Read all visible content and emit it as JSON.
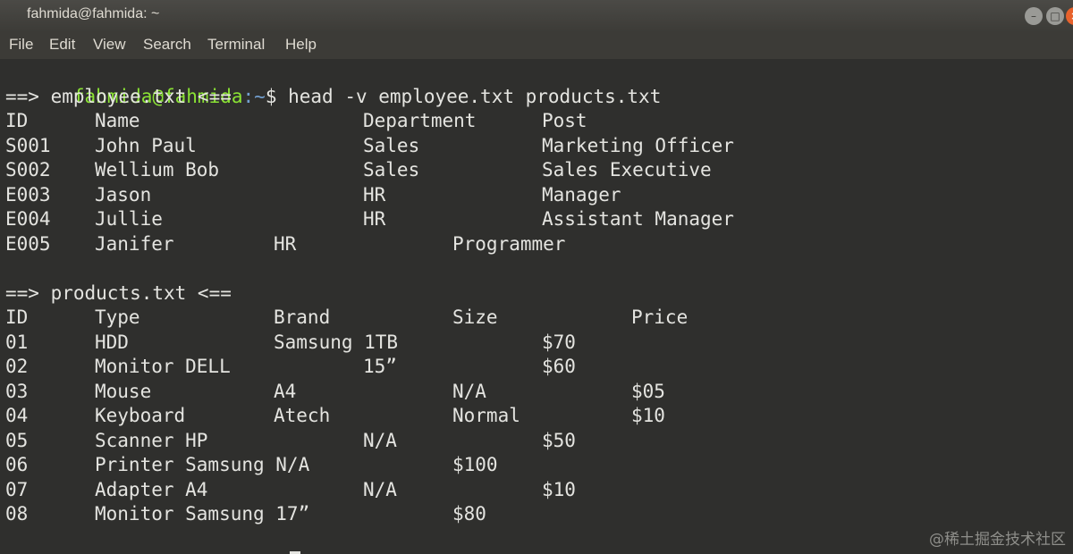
{
  "window": {
    "title": "fahmida@fahmida: ~",
    "buttons": {
      "minimize": "–",
      "maximize": "□",
      "close": "×"
    }
  },
  "menu": [
    "File",
    "Edit",
    "View",
    "Search",
    "Terminal",
    "Help"
  ],
  "prompt": {
    "user": "fahmida@fahmida",
    "path": ":~",
    "symbol": "$"
  },
  "command": "head -v employee.txt products.txt",
  "employee_header": "==> employee.txt <==",
  "employee_columns": [
    "ID",
    "Name",
    "Department",
    "Post"
  ],
  "employee_rows": [
    [
      "S001",
      "John Paul",
      "Sales",
      "Marketing Officer"
    ],
    [
      "S002",
      "Wellium Bob",
      "Sales",
      "Sales Executive"
    ],
    [
      "E003",
      "Jason",
      "HR",
      "Manager"
    ],
    [
      "E004",
      "Jullie",
      "HR",
      "Assistant Manager"
    ],
    [
      "E005",
      "Janifer",
      "HR",
      "Programmer"
    ]
  ],
  "products_header": "==> products.txt <==",
  "product_columns": [
    "ID",
    "Type",
    "Brand",
    "Size",
    "Price"
  ],
  "product_rows": [
    [
      "01",
      "HDD",
      "Samsung 1TB",
      "$70"
    ],
    [
      "02",
      "Monitor DELL",
      "15”",
      "$60"
    ],
    [
      "03",
      "Mouse",
      "A4",
      "N/A",
      "$05"
    ],
    [
      "04",
      "Keyboard",
      "Atech",
      "Normal",
      "$10"
    ],
    [
      "05",
      "Scanner HP",
      "N/A",
      "$50"
    ],
    [
      "06",
      "Printer Samsung N/A",
      "$100"
    ],
    [
      "07",
      "Adapter A4",
      "N/A",
      "$10"
    ],
    [
      "08",
      "Monitor Samsung 17”",
      "$80"
    ]
  ],
  "watermark": "@稀土掘金技术社区",
  "colors": {
    "background": "#2f2f2d",
    "text": "#e4e4e0",
    "prompt_user": "#8ae234",
    "prompt_path": "#729fcf"
  }
}
